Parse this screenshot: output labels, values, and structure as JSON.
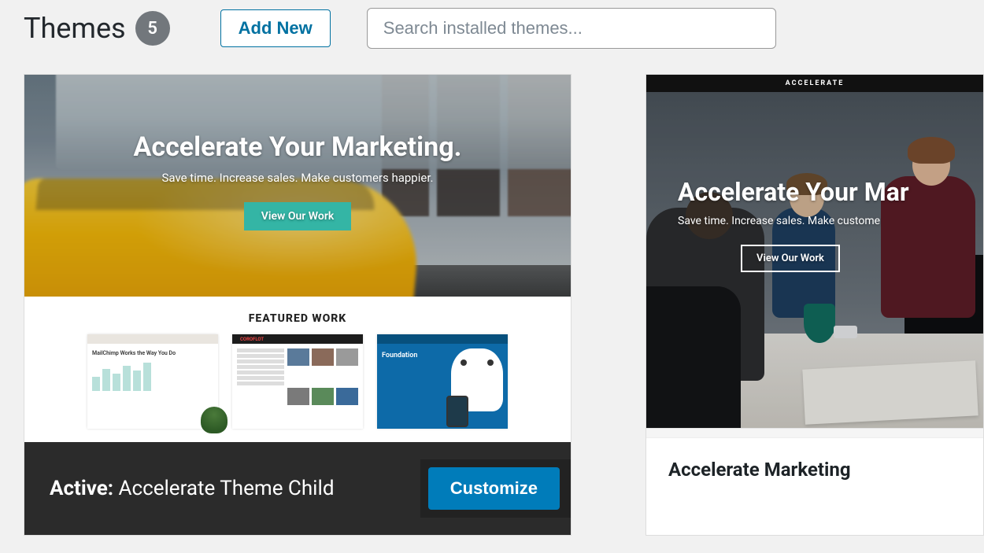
{
  "header": {
    "title": "Themes",
    "count": "5",
    "add_new_label": "Add New",
    "search_placeholder": "Search installed themes..."
  },
  "themes": {
    "active": {
      "active_prefix": "Active:",
      "name": "Accelerate Theme Child",
      "customize_label": "Customize",
      "hero_heading": "Accelerate Your Marketing.",
      "hero_sub": "Save time. Increase sales. Make customers happier.",
      "hero_cta": "View Our Work",
      "featured_title": "FEATURED WORK",
      "work1_tag": "MailChimp Works the Way You Do",
      "work2_brand": "COROFLOT",
      "work3_title": "Foundation"
    },
    "second": {
      "logo": "ACCELERATE",
      "name": "Accelerate Marketing",
      "hero_heading": "Accelerate Your Mar",
      "hero_sub": "Save time. Increase sales. Make custome",
      "hero_cta": "View Our Work"
    }
  }
}
